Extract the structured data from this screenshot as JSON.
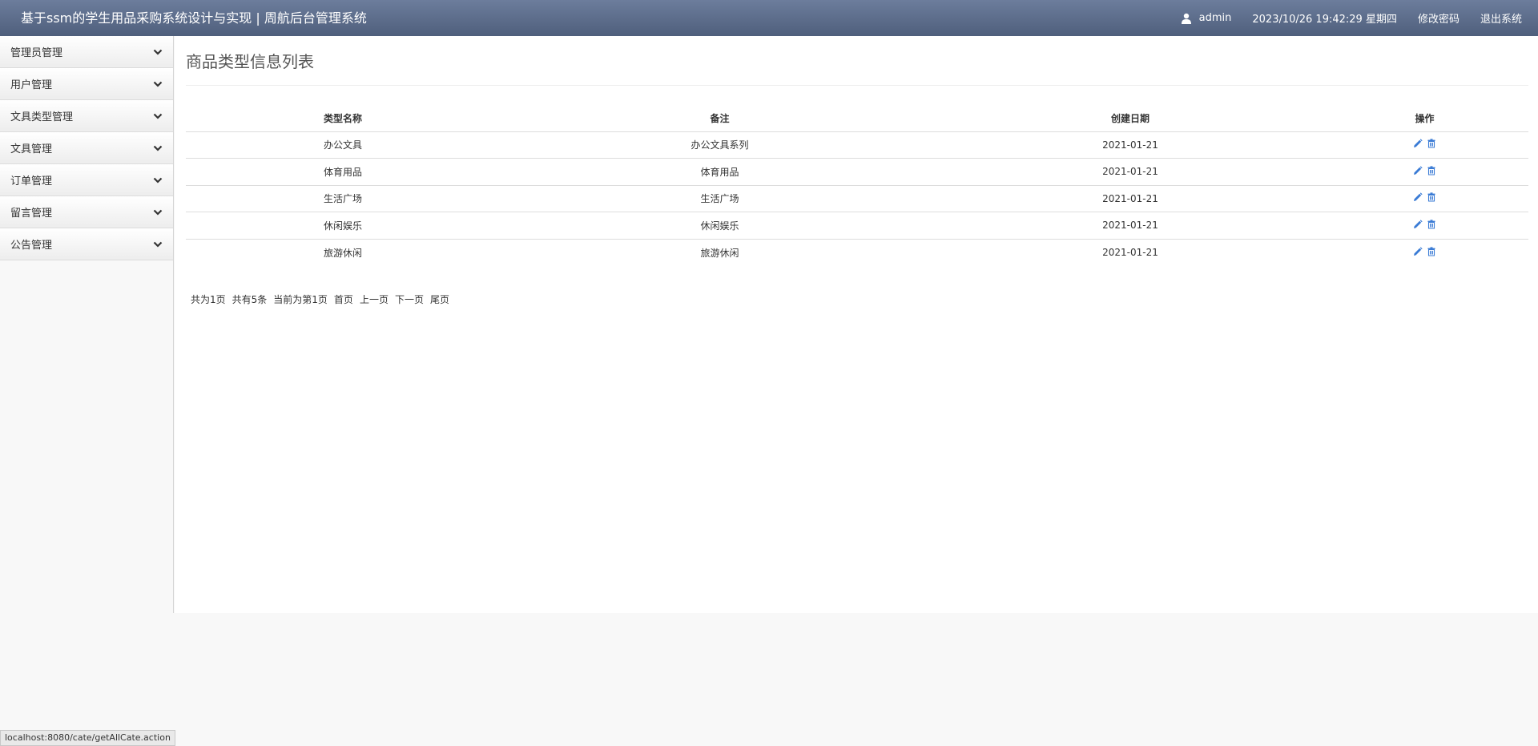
{
  "header": {
    "title": "基于ssm的学生用品采购系统设计与实现 | 周航后台管理系统",
    "user": "admin",
    "datetime": "2023/10/26 19:42:29 星期四",
    "change_password": "修改密码",
    "logout": "退出系统"
  },
  "sidebar": {
    "items": [
      {
        "label": "管理员管理"
      },
      {
        "label": "用户管理"
      },
      {
        "label": "文具类型管理"
      },
      {
        "label": "文具管理"
      },
      {
        "label": "订单管理"
      },
      {
        "label": "留言管理"
      },
      {
        "label": "公告管理"
      }
    ]
  },
  "main": {
    "title": "商品类型信息列表",
    "table": {
      "headers": [
        "类型名称",
        "备注",
        "创建日期",
        "操作"
      ],
      "rows": [
        {
          "name": "办公文具",
          "note": "办公文具系列",
          "date": "2021-01-21"
        },
        {
          "name": "体育用品",
          "note": "体育用品",
          "date": "2021-01-21"
        },
        {
          "name": "生活广场",
          "note": "生活广场",
          "date": "2021-01-21"
        },
        {
          "name": "休闲娱乐",
          "note": "休闲娱乐",
          "date": "2021-01-21"
        },
        {
          "name": "旅游休闲",
          "note": "旅游休闲",
          "date": "2021-01-21"
        }
      ]
    },
    "pagination": {
      "total_pages": "共为1页",
      "total_items": "共有5条",
      "current": "当前为第1页",
      "first": "首页",
      "prev": "上一页",
      "next": "下一页",
      "last": "尾页"
    }
  },
  "status_bar": {
    "url": "localhost:8080/cate/getAllCate.action"
  },
  "icons": {
    "user": "user-icon",
    "chevron": "chevron-down-icon",
    "edit": "pencil-icon",
    "delete": "trash-icon"
  },
  "colors": {
    "header_top": "#6c7d9c",
    "header_bottom": "#4f5f7c",
    "icon_blue": "#3a7bd5"
  }
}
